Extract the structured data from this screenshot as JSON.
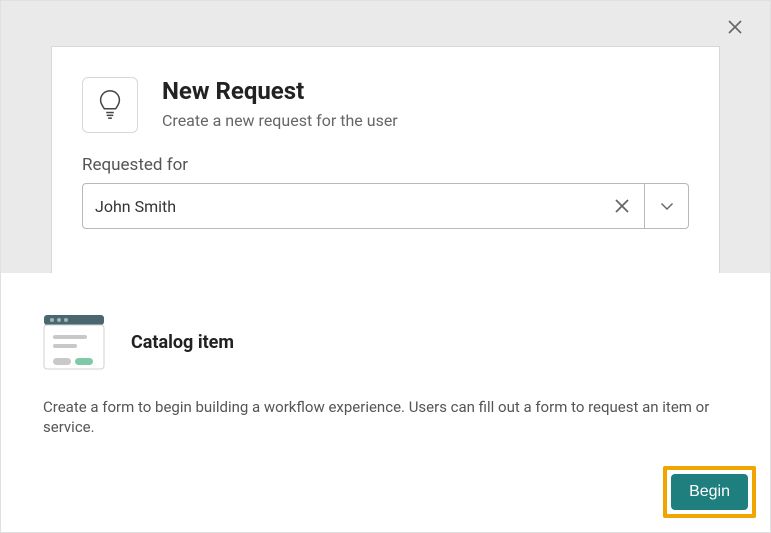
{
  "modal": {
    "title": "New Request",
    "subtitle": "Create a new request for the user",
    "requested_for_label": "Requested for",
    "requested_for_value": "John Smith"
  },
  "catalog": {
    "title": "Catalog item",
    "description": "Create a form to begin building a workflow experience. Users can fill out a form to request an item or service.",
    "begin_label": "Begin"
  }
}
